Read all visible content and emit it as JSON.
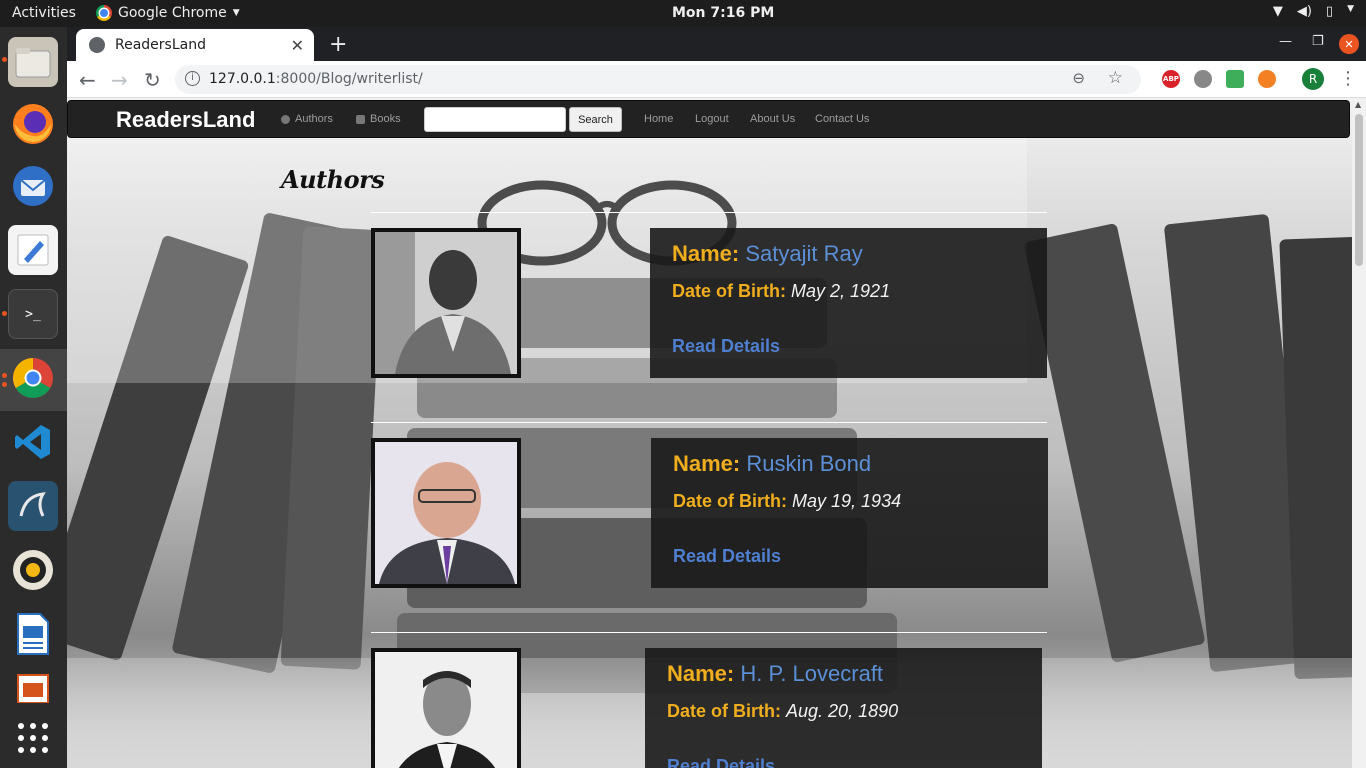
{
  "topbar": {
    "activities": "Activities",
    "app_name": "Google Chrome",
    "clock": "Mon  7:16 PM"
  },
  "browser": {
    "tab_title": "ReadersLand",
    "url_host": "127.0.0.1",
    "url_rest": ":8000/Blog/writerlist/",
    "profile_initial": "R",
    "ext_abp": "ABP"
  },
  "site": {
    "brand": "ReadersLand",
    "nav_authors": "Authors",
    "nav_books": "Books",
    "search_button": "Search",
    "nav_home": "Home",
    "nav_logout": "Logout",
    "nav_about": "About Us",
    "nav_contact": "Contact Us",
    "heading": "Authors"
  },
  "authors": [
    {
      "name_label": "Name:",
      "name": "Satyajit Ray",
      "dob_label": "Date of Birth:",
      "dob": "May 2, 1921",
      "link": "Read Details"
    },
    {
      "name_label": "Name:",
      "name": "Ruskin Bond",
      "dob_label": "Date of Birth:",
      "dob": "May 19, 1934",
      "link": "Read Details"
    },
    {
      "name_label": "Name:",
      "name": "H. P. Lovecraft",
      "dob_label": "Date of Birth:",
      "dob": "Aug. 20, 1890",
      "link": "Read Details"
    }
  ],
  "colors": {
    "label_gold": "#f0ad1e",
    "name_blue": "#5b8fd6",
    "link_blue": "#4f7fd0",
    "navbar_bg": "#222222"
  }
}
